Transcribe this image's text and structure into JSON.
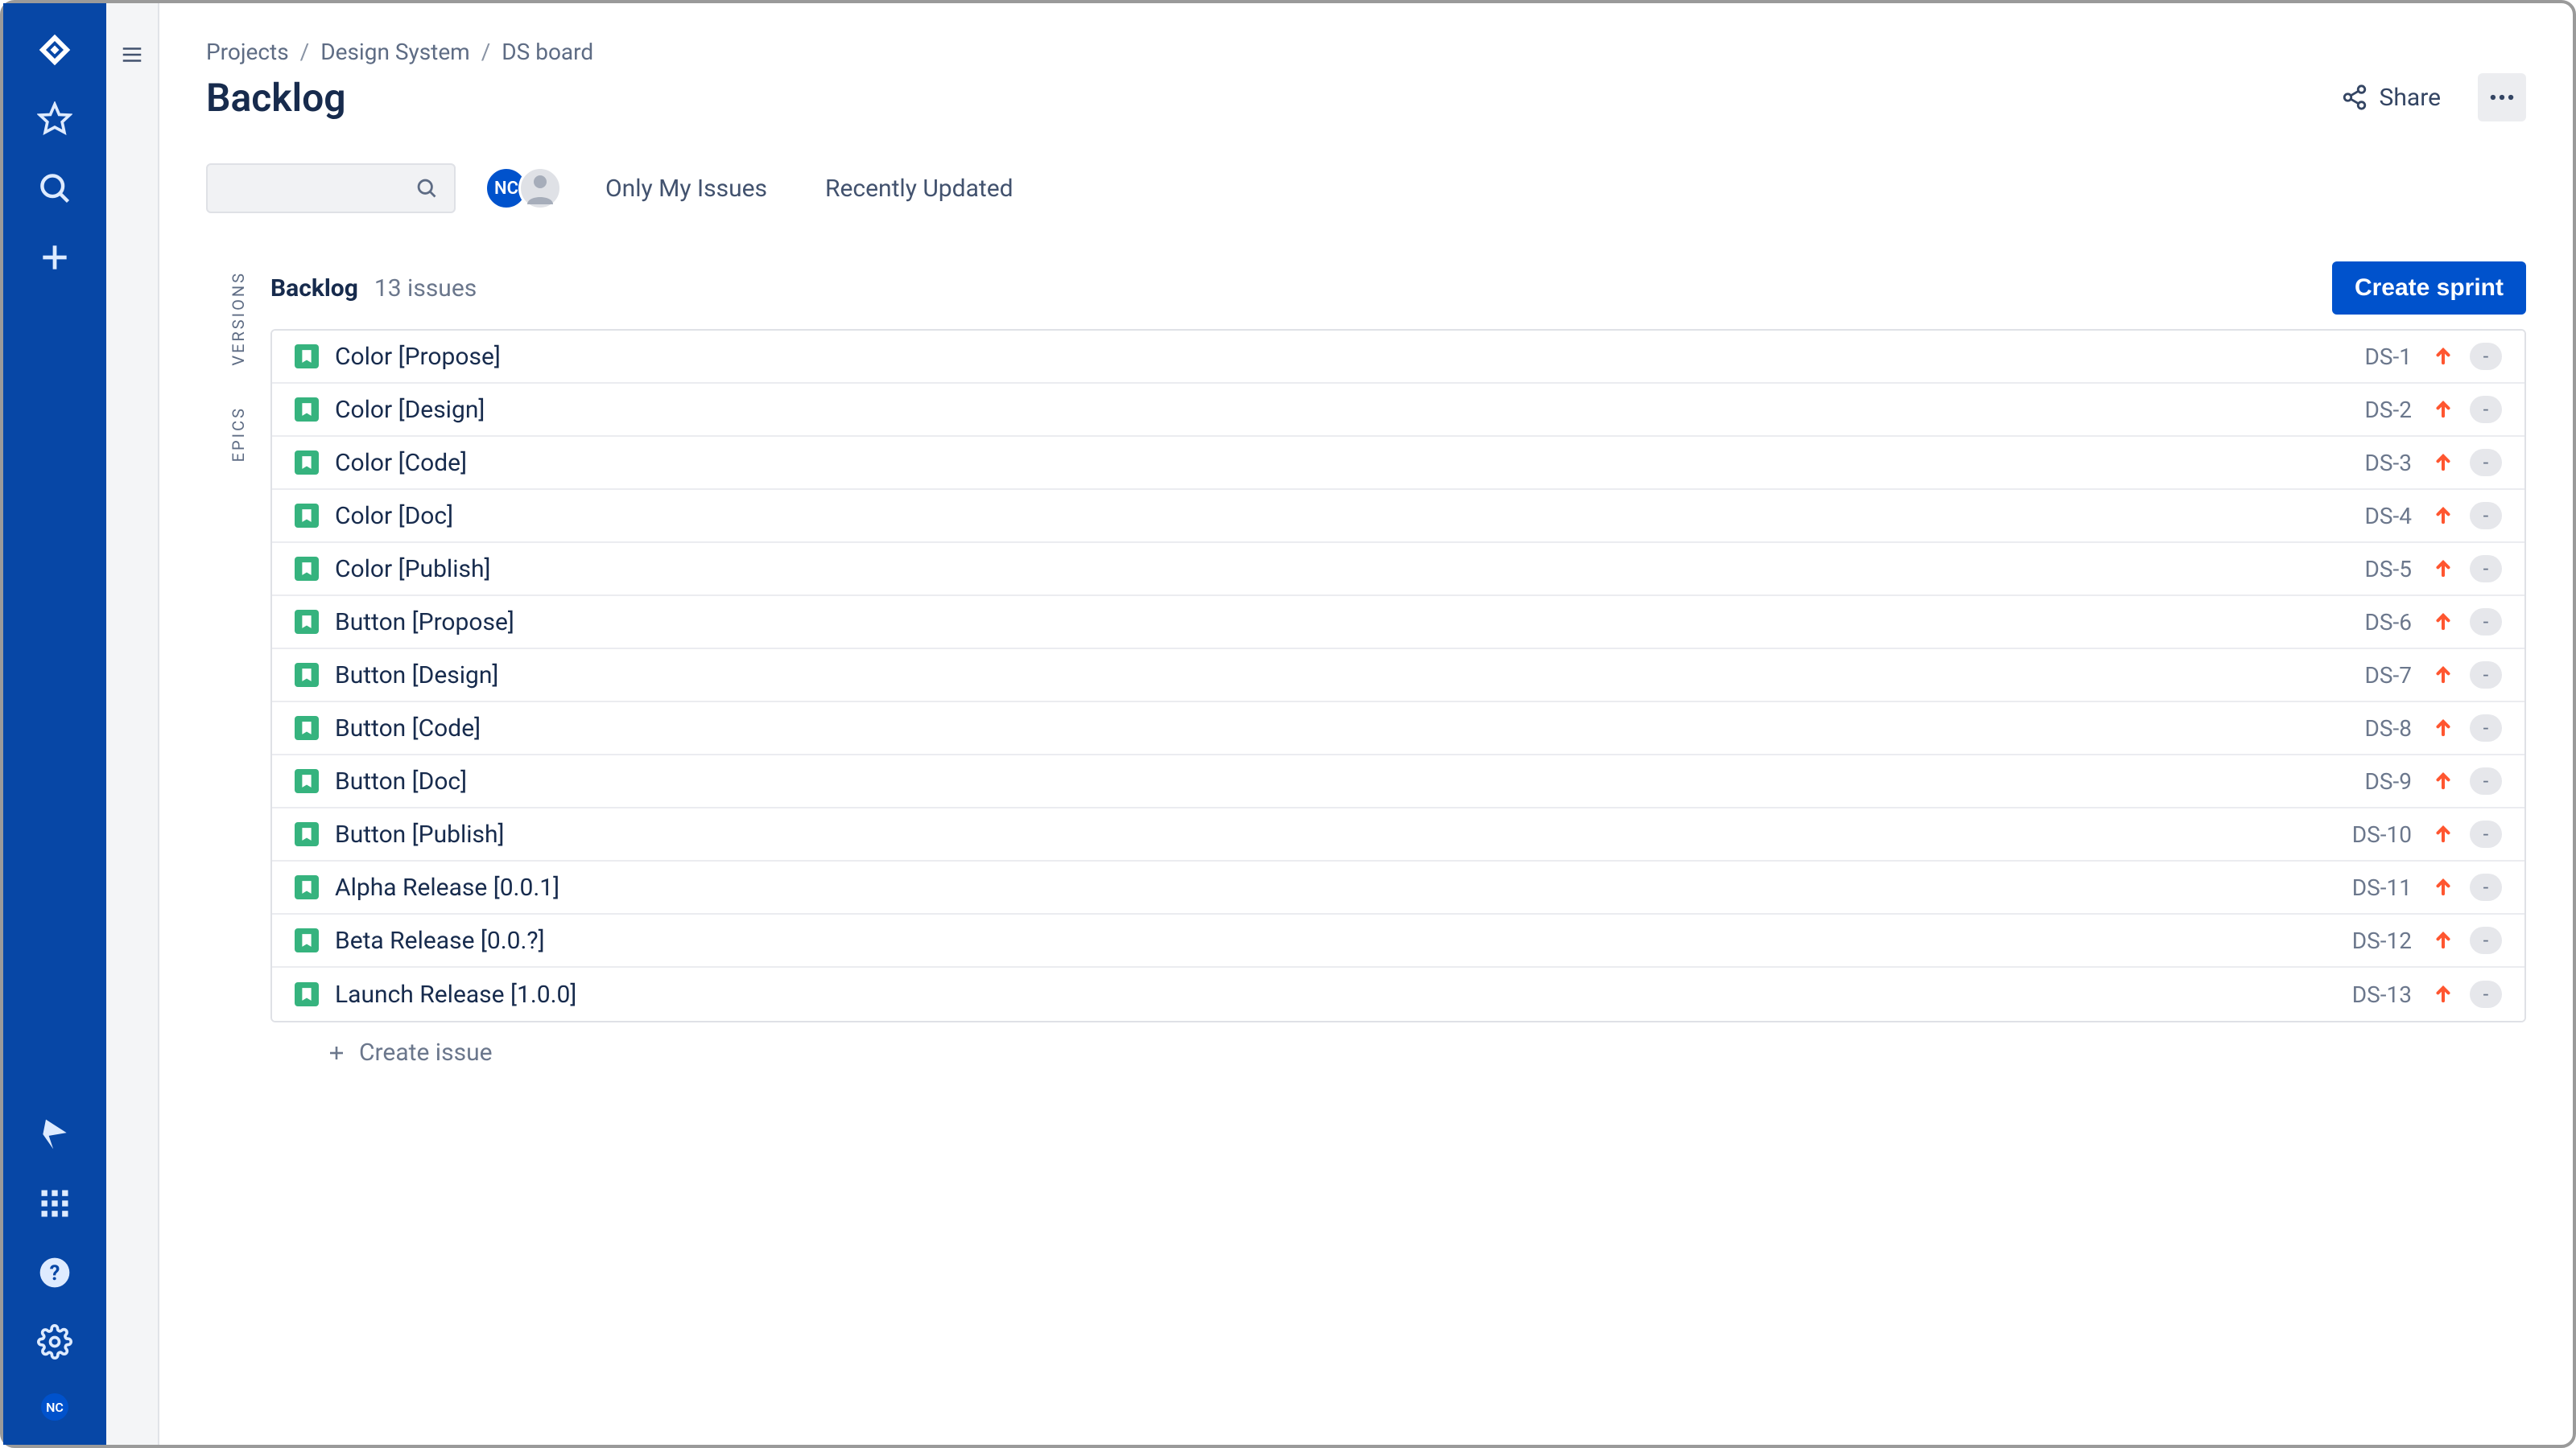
{
  "breadcrumb": {
    "projects": "Projects",
    "project": "Design System",
    "board": "DS board"
  },
  "page_title": "Backlog",
  "share_label": "Share",
  "search_placeholder": "",
  "avatar_initials": "NC",
  "quick_filters": {
    "only_my": "Only My Issues",
    "recent": "Recently Updated"
  },
  "side_tabs": {
    "versions": "VERSIONS",
    "epics": "EPICS"
  },
  "backlog": {
    "label": "Backlog",
    "count_text": "13 issues",
    "create_sprint": "Create sprint",
    "create_issue": "Create issue",
    "issues": [
      {
        "title": "Color [Propose]",
        "key": "DS-1",
        "assignee": "-"
      },
      {
        "title": "Color [Design]",
        "key": "DS-2",
        "assignee": "-"
      },
      {
        "title": "Color [Code]",
        "key": "DS-3",
        "assignee": "-"
      },
      {
        "title": "Color [Doc]",
        "key": "DS-4",
        "assignee": "-"
      },
      {
        "title": "Color [Publish]",
        "key": "DS-5",
        "assignee": "-"
      },
      {
        "title": "Button [Propose]",
        "key": "DS-6",
        "assignee": "-"
      },
      {
        "title": "Button [Design]",
        "key": "DS-7",
        "assignee": "-"
      },
      {
        "title": "Button [Code]",
        "key": "DS-8",
        "assignee": "-"
      },
      {
        "title": "Button [Doc]",
        "key": "DS-9",
        "assignee": "-"
      },
      {
        "title": "Button [Publish]",
        "key": "DS-10",
        "assignee": "-"
      },
      {
        "title": "Alpha Release [0.0.1]",
        "key": "DS-11",
        "assignee": "-"
      },
      {
        "title": "Beta Release [0.0.?]",
        "key": "DS-12",
        "assignee": "-"
      },
      {
        "title": "Launch Release [1.0.0]",
        "key": "DS-13",
        "assignee": "-"
      }
    ]
  }
}
